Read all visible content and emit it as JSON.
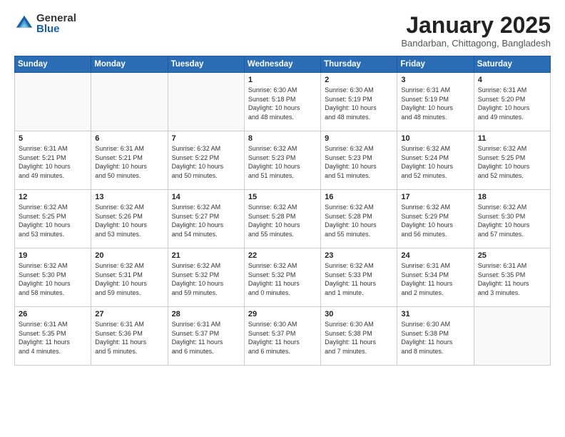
{
  "header": {
    "logo_general": "General",
    "logo_blue": "Blue",
    "month_title": "January 2025",
    "subtitle": "Bandarban, Chittagong, Bangladesh"
  },
  "days_of_week": [
    "Sunday",
    "Monday",
    "Tuesday",
    "Wednesday",
    "Thursday",
    "Friday",
    "Saturday"
  ],
  "weeks": [
    [
      {
        "day": "",
        "info": ""
      },
      {
        "day": "",
        "info": ""
      },
      {
        "day": "",
        "info": ""
      },
      {
        "day": "1",
        "info": "Sunrise: 6:30 AM\nSunset: 5:18 PM\nDaylight: 10 hours\nand 48 minutes."
      },
      {
        "day": "2",
        "info": "Sunrise: 6:30 AM\nSunset: 5:19 PM\nDaylight: 10 hours\nand 48 minutes."
      },
      {
        "day": "3",
        "info": "Sunrise: 6:31 AM\nSunset: 5:19 PM\nDaylight: 10 hours\nand 48 minutes."
      },
      {
        "day": "4",
        "info": "Sunrise: 6:31 AM\nSunset: 5:20 PM\nDaylight: 10 hours\nand 49 minutes."
      }
    ],
    [
      {
        "day": "5",
        "info": "Sunrise: 6:31 AM\nSunset: 5:21 PM\nDaylight: 10 hours\nand 49 minutes."
      },
      {
        "day": "6",
        "info": "Sunrise: 6:31 AM\nSunset: 5:21 PM\nDaylight: 10 hours\nand 50 minutes."
      },
      {
        "day": "7",
        "info": "Sunrise: 6:32 AM\nSunset: 5:22 PM\nDaylight: 10 hours\nand 50 minutes."
      },
      {
        "day": "8",
        "info": "Sunrise: 6:32 AM\nSunset: 5:23 PM\nDaylight: 10 hours\nand 51 minutes."
      },
      {
        "day": "9",
        "info": "Sunrise: 6:32 AM\nSunset: 5:23 PM\nDaylight: 10 hours\nand 51 minutes."
      },
      {
        "day": "10",
        "info": "Sunrise: 6:32 AM\nSunset: 5:24 PM\nDaylight: 10 hours\nand 52 minutes."
      },
      {
        "day": "11",
        "info": "Sunrise: 6:32 AM\nSunset: 5:25 PM\nDaylight: 10 hours\nand 52 minutes."
      }
    ],
    [
      {
        "day": "12",
        "info": "Sunrise: 6:32 AM\nSunset: 5:25 PM\nDaylight: 10 hours\nand 53 minutes."
      },
      {
        "day": "13",
        "info": "Sunrise: 6:32 AM\nSunset: 5:26 PM\nDaylight: 10 hours\nand 53 minutes."
      },
      {
        "day": "14",
        "info": "Sunrise: 6:32 AM\nSunset: 5:27 PM\nDaylight: 10 hours\nand 54 minutes."
      },
      {
        "day": "15",
        "info": "Sunrise: 6:32 AM\nSunset: 5:28 PM\nDaylight: 10 hours\nand 55 minutes."
      },
      {
        "day": "16",
        "info": "Sunrise: 6:32 AM\nSunset: 5:28 PM\nDaylight: 10 hours\nand 55 minutes."
      },
      {
        "day": "17",
        "info": "Sunrise: 6:32 AM\nSunset: 5:29 PM\nDaylight: 10 hours\nand 56 minutes."
      },
      {
        "day": "18",
        "info": "Sunrise: 6:32 AM\nSunset: 5:30 PM\nDaylight: 10 hours\nand 57 minutes."
      }
    ],
    [
      {
        "day": "19",
        "info": "Sunrise: 6:32 AM\nSunset: 5:30 PM\nDaylight: 10 hours\nand 58 minutes."
      },
      {
        "day": "20",
        "info": "Sunrise: 6:32 AM\nSunset: 5:31 PM\nDaylight: 10 hours\nand 59 minutes."
      },
      {
        "day": "21",
        "info": "Sunrise: 6:32 AM\nSunset: 5:32 PM\nDaylight: 10 hours\nand 59 minutes."
      },
      {
        "day": "22",
        "info": "Sunrise: 6:32 AM\nSunset: 5:32 PM\nDaylight: 11 hours\nand 0 minutes."
      },
      {
        "day": "23",
        "info": "Sunrise: 6:32 AM\nSunset: 5:33 PM\nDaylight: 11 hours\nand 1 minute."
      },
      {
        "day": "24",
        "info": "Sunrise: 6:31 AM\nSunset: 5:34 PM\nDaylight: 11 hours\nand 2 minutes."
      },
      {
        "day": "25",
        "info": "Sunrise: 6:31 AM\nSunset: 5:35 PM\nDaylight: 11 hours\nand 3 minutes."
      }
    ],
    [
      {
        "day": "26",
        "info": "Sunrise: 6:31 AM\nSunset: 5:35 PM\nDaylight: 11 hours\nand 4 minutes."
      },
      {
        "day": "27",
        "info": "Sunrise: 6:31 AM\nSunset: 5:36 PM\nDaylight: 11 hours\nand 5 minutes."
      },
      {
        "day": "28",
        "info": "Sunrise: 6:31 AM\nSunset: 5:37 PM\nDaylight: 11 hours\nand 6 minutes."
      },
      {
        "day": "29",
        "info": "Sunrise: 6:30 AM\nSunset: 5:37 PM\nDaylight: 11 hours\nand 6 minutes."
      },
      {
        "day": "30",
        "info": "Sunrise: 6:30 AM\nSunset: 5:38 PM\nDaylight: 11 hours\nand 7 minutes."
      },
      {
        "day": "31",
        "info": "Sunrise: 6:30 AM\nSunset: 5:38 PM\nDaylight: 11 hours\nand 8 minutes."
      },
      {
        "day": "",
        "info": ""
      }
    ]
  ]
}
